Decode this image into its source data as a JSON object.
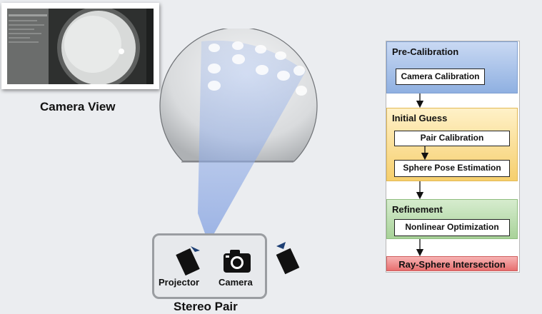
{
  "captions": {
    "camera_view": "Camera View",
    "stereo_pair": "Stereo Pair",
    "projector": "Projector",
    "camera": "Camera"
  },
  "flowchart": {
    "stages": [
      {
        "title": "Pre-Calibration",
        "color": "#8fb0e1",
        "steps": [
          "Camera Calibration"
        ]
      },
      {
        "title": "Initial Guess",
        "color": "#f6cf6d",
        "steps": [
          "Pair Calibration",
          "Sphere Pose Estimation"
        ]
      },
      {
        "title": "Refinement",
        "color": "#a8d299",
        "steps": [
          "Nonlinear Optimization"
        ]
      },
      {
        "title": "Ray-Sphere Intersection",
        "color": "#e76f6f",
        "steps": []
      }
    ]
  },
  "icons": [
    "projector-icon",
    "camera-icon",
    "projector-icon"
  ]
}
